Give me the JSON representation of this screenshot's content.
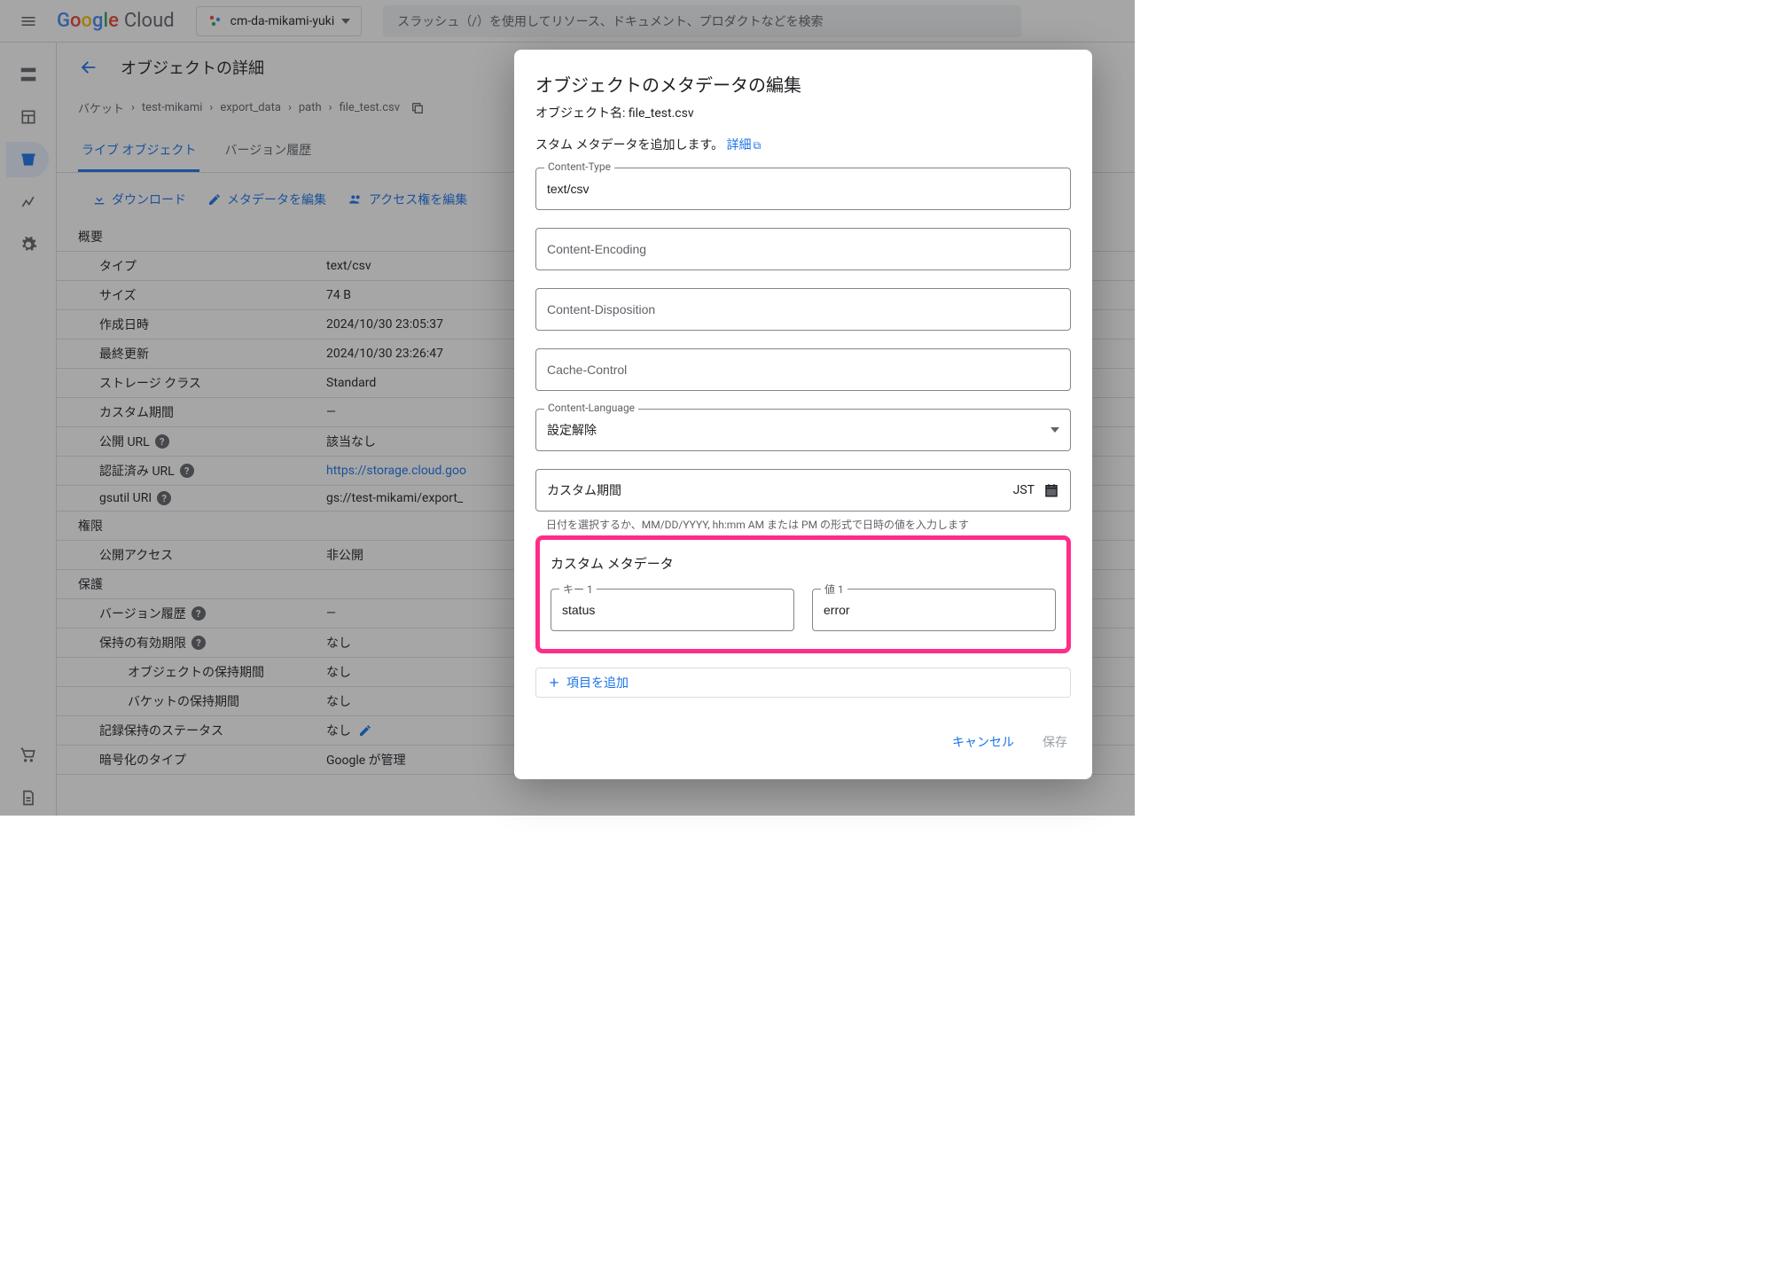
{
  "header": {
    "logo": "Google Cloud",
    "project": "cm-da-mikami-yuki",
    "search_placeholder": "スラッシュ（/）を使用してリソース、ドキュメント、プロダクトなどを検索"
  },
  "page": {
    "title": "オブジェクトの詳細",
    "breadcrumbs": [
      "バケット",
      "test-mikami",
      "export_data",
      "path",
      "file_test.csv"
    ],
    "tabs": {
      "live": "ライブ オブジェクト",
      "history": "バージョン履歴"
    },
    "toolbar": {
      "download": "ダウンロード",
      "edit_meta": "メタデータを編集",
      "edit_access": "アクセス権を編集"
    }
  },
  "sections": {
    "overview_head": "概要",
    "permissions_head": "権限",
    "protection_head": "保護",
    "rows": {
      "type_l": "タイプ",
      "type_v": "text/csv",
      "size_l": "サイズ",
      "size_v": "74 B",
      "created_l": "作成日時",
      "created_v": "2024/10/30 23:05:37",
      "updated_l": "最終更新",
      "updated_v": "2024/10/30 23:26:47",
      "storage_l": "ストレージ クラス",
      "storage_v": "Standard",
      "custom_l": "カスタム期間",
      "custom_v": "—",
      "public_l": "公開 URL",
      "public_v": "該当なし",
      "auth_l": "認証済み URL",
      "auth_v": "https://storage.cloud.goo",
      "gsutil_l": "gsutil URI",
      "gsutil_v": "gs://test-mikami/export_",
      "access_l": "公開アクセス",
      "access_v": "非公開",
      "vh_l": "バージョン履歴",
      "vh_v": "—",
      "retain_l": "保持の有効期限",
      "retain_v": "なし",
      "obj_retain_l": "オブジェクトの保持期間",
      "obj_retain_v": "なし",
      "bucket_retain_l": "バケットの保持期間",
      "bucket_retain_v": "なし",
      "record_l": "記録保持のステータス",
      "record_v": "なし",
      "enc_l": "暗号化のタイプ",
      "enc_v": "Google が管理"
    }
  },
  "dialog": {
    "title": "オブジェクトのメタデータの編集",
    "object_name_label": "オブジェクト名:",
    "object_name": "file_test.csv",
    "intro": "スタム メタデータを追加します。",
    "details_link": "詳細",
    "fields": {
      "content_type_label": "Content-Type",
      "content_type_value": "text/csv",
      "content_encoding_label": "Content-Encoding",
      "content_disposition_label": "Content-Disposition",
      "cache_control_label": "Cache-Control",
      "content_language_label": "Content-Language",
      "content_language_value": "設定解除",
      "custom_period_label": "カスタム期間",
      "custom_period_tz": "JST",
      "date_helper": "日付を選択するか、MM/DD/YYYY, hh:mm AM または PM の形式で日時の値を入力します"
    },
    "custom": {
      "head": "カスタム メタデータ",
      "key_label": "キー 1",
      "key_value": "status",
      "val_label": "値 1",
      "val_value": "error",
      "add_item": "項目を追加"
    },
    "actions": {
      "cancel": "キャンセル",
      "save": "保存"
    }
  }
}
